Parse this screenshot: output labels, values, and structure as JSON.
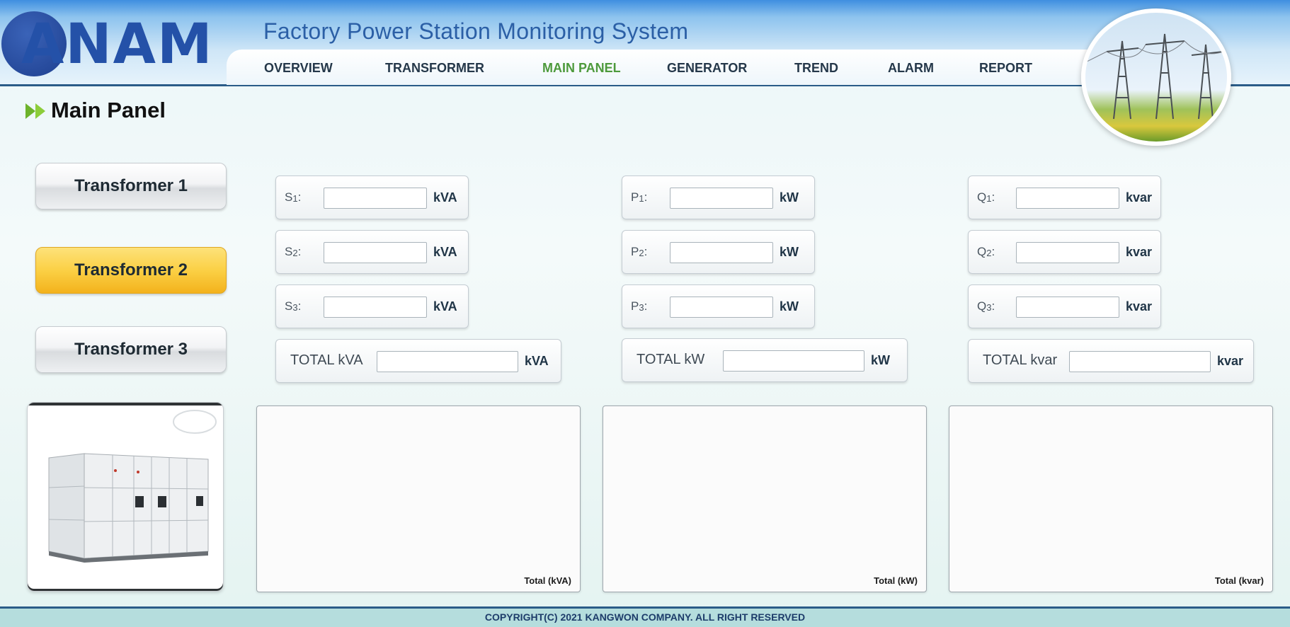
{
  "header": {
    "logo_text": "ANAM",
    "title": "Factory Power Station Monitoring System",
    "nav": [
      {
        "label": "OVERVIEW",
        "active": false
      },
      {
        "label": "TRANSFORMER",
        "active": false
      },
      {
        "label": "MAIN PANEL",
        "active": true
      },
      {
        "label": "GENERATOR",
        "active": false
      },
      {
        "label": "TREND",
        "active": false
      },
      {
        "label": "ALARM",
        "active": false
      },
      {
        "label": "REPORT",
        "active": false
      }
    ]
  },
  "page": {
    "title": "Main Panel"
  },
  "transformers": [
    {
      "label": "Transformer 1",
      "active": false
    },
    {
      "label": "Transformer 2",
      "active": true
    },
    {
      "label": "Transformer 3",
      "active": false
    }
  ],
  "groups": {
    "s": {
      "rows": [
        {
          "label": "S",
          "sub": "1",
          "suffix": ":",
          "value": "",
          "unit": "kVA"
        },
        {
          "label": "S",
          "sub": "2",
          "suffix": ":",
          "value": "",
          "unit": "kVA"
        },
        {
          "label": "S",
          "sub": "3",
          "suffix": ":",
          "value": "",
          "unit": "kVA"
        }
      ],
      "total": {
        "label": "TOTAL kVA",
        "value": "",
        "unit": "kVA"
      },
      "chart_label": "Total (kVA)"
    },
    "p": {
      "rows": [
        {
          "label": "P",
          "sub": "1",
          "suffix": ":",
          "value": "",
          "unit": "kW"
        },
        {
          "label": "P",
          "sub": "2",
          "suffix": ":",
          "value": "",
          "unit": "kW"
        },
        {
          "label": "P",
          "sub": "3",
          "suffix": ":",
          "value": "",
          "unit": "kW"
        }
      ],
      "total": {
        "label": "TOTAL kW",
        "value": "",
        "unit": "kW"
      },
      "chart_label": "Total (kW)"
    },
    "q": {
      "rows": [
        {
          "label": "Q",
          "sub": "1",
          "suffix": ":",
          "value": "",
          "unit": "kvar"
        },
        {
          "label": "Q",
          "sub": "2",
          "suffix": ":",
          "value": "",
          "unit": "kvar"
        },
        {
          "label": "Q",
          "sub": "3",
          "suffix": ":",
          "value": "",
          "unit": "kvar"
        }
      ],
      "total": {
        "label": "TOTAL kvar",
        "value": "",
        "unit": "kvar"
      },
      "chart_label": "Total (kvar)"
    }
  },
  "footer": {
    "copyright": "COPYRIGHT(C) 2021 KANGWON COMPANY. ALL RIGHT RESERVED"
  },
  "colors": {
    "active_nav": "#4d9a3c",
    "active_button": "#fbd045",
    "brand_blue": "#2451a8",
    "footer_bg": "#b5dddd"
  }
}
